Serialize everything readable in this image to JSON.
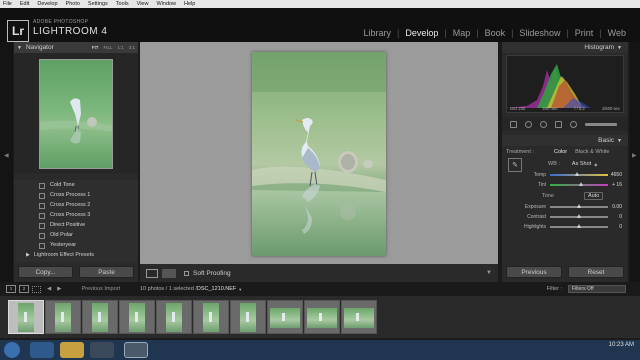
{
  "menubar": [
    "File",
    "Edit",
    "Develop",
    "Photo",
    "Settings",
    "Tools",
    "View",
    "Window",
    "Help"
  ],
  "app": {
    "logo": "Lr",
    "vendor": "ADOBE PHOTOSHOP",
    "name": "LIGHTROOM 4"
  },
  "modules": [
    {
      "label": "Library",
      "active": false
    },
    {
      "label": "Develop",
      "active": true
    },
    {
      "label": "Map",
      "active": false
    },
    {
      "label": "Book",
      "active": false
    },
    {
      "label": "Slideshow",
      "active": false
    },
    {
      "label": "Print",
      "active": false
    },
    {
      "label": "Web",
      "active": false
    }
  ],
  "navigator": {
    "title": "Navigator",
    "zoom_options": [
      "FIT",
      "FILL",
      "1:1",
      "3:1"
    ],
    "zoom_selected": "FIT"
  },
  "presets": {
    "items": [
      "Cold Tone",
      "Cross Process 1",
      "Cross Process 2",
      "Cross Process 3",
      "Direct Positive",
      "Old Polar",
      "Yesteryear"
    ],
    "folder": "Lightroom Effect Presets"
  },
  "left_buttons": {
    "copy": "Copy...",
    "paste": "Paste"
  },
  "toolbar": {
    "soft_proofing": "Soft Proofing"
  },
  "histogram": {
    "title": "Histogram",
    "iso": "ISO 200",
    "focal": "200 mm",
    "aperture": "f / 5.2",
    "shutter": "1/500 sec"
  },
  "basic": {
    "title": "Basic",
    "treatment_label": "Treatment :",
    "treatment_options": [
      {
        "label": "Color",
        "active": true
      },
      {
        "label": "Black & White",
        "active": false
      }
    ],
    "wb_label": "WB :",
    "wb_value": "As Shot",
    "sliders": [
      {
        "label": "Temp",
        "value": "4650",
        "position": 0.48
      },
      {
        "label": "Tint",
        "value": "+ 16",
        "position": 0.55
      }
    ],
    "tone_label": "Tone",
    "auto_label": "Auto",
    "tone_sliders": [
      {
        "label": "Exposure",
        "value": "0.00",
        "position": 0.5
      },
      {
        "label": "Contrast",
        "value": "0",
        "position": 0.5
      },
      {
        "label": "Highlights",
        "value": "0",
        "position": 0.5
      }
    ]
  },
  "right_buttons": {
    "previous": "Previous",
    "reset": "Reset"
  },
  "filmstrip_bar": {
    "page1": "1",
    "page2": "2",
    "source": "Previous Import",
    "count": "10 photos / 1 selected /",
    "file": "DSC_1210.NEF",
    "filter_label": "Filter :",
    "filter_value": "Filters Off"
  },
  "filmstrip": {
    "thumb_count": 10,
    "selected_index": 0
  },
  "taskbar": {
    "time": "10:23 AM"
  }
}
